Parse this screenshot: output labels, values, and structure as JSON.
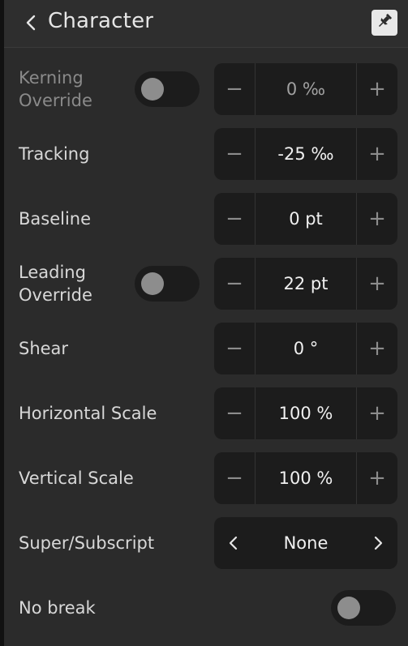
{
  "header": {
    "title": "Character",
    "back_icon": "chevron-left-icon",
    "pin_icon": "pin-icon"
  },
  "rows": {
    "kerning_override": {
      "label": "Kerning Override",
      "toggle_on": false,
      "value": "0 ‰",
      "minus": "−",
      "plus": "+"
    },
    "tracking": {
      "label": "Tracking",
      "value": "-25 ‰",
      "minus": "−",
      "plus": "+"
    },
    "baseline": {
      "label": "Baseline",
      "value": "0 pt",
      "minus": "−",
      "plus": "+"
    },
    "leading_override": {
      "label": "Leading Override",
      "toggle_on": false,
      "value": "22 pt",
      "minus": "−",
      "plus": "+"
    },
    "shear": {
      "label": "Shear",
      "value": "0 °",
      "minus": "−",
      "plus": "+"
    },
    "horizontal_scale": {
      "label": "Horizontal Scale",
      "value": "100 %",
      "minus": "−",
      "plus": "+"
    },
    "vertical_scale": {
      "label": "Vertical Scale",
      "value": "100 %",
      "minus": "−",
      "plus": "+"
    },
    "super_subscript": {
      "label": "Super/Subscript",
      "value": "None"
    },
    "no_break": {
      "label": "No break",
      "toggle_on": false
    }
  },
  "colors": {
    "panel_bg": "#2b2b2b",
    "control_bg": "#1c1c1c",
    "text": "#e9e9e9",
    "dim_text": "#8a8a8a",
    "knob": "#8d8d8d"
  }
}
